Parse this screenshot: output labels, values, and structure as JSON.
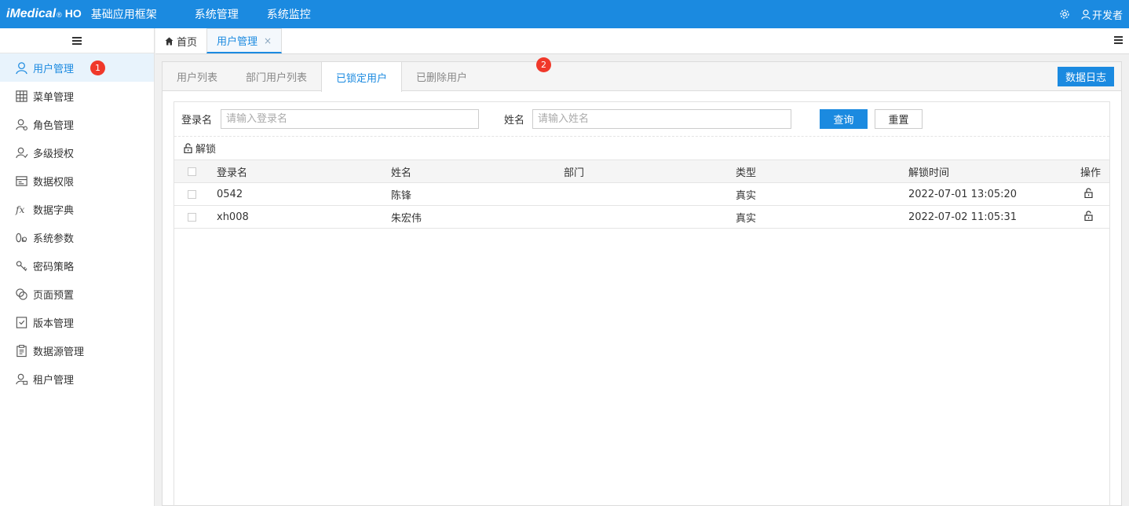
{
  "header": {
    "brand": "iMedical",
    "brand_mark": "®",
    "brand_suffix": "HO",
    "app_title": "基础应用框架",
    "nav": [
      "系统管理",
      "系统监控"
    ],
    "user": "开发者",
    "accent": "#1b8ae0"
  },
  "sidebar": {
    "items": [
      {
        "label": "用户管理",
        "icon": "user-icon",
        "active": true
      },
      {
        "label": "菜单管理",
        "icon": "grid-icon"
      },
      {
        "label": "角色管理",
        "icon": "role-icon"
      },
      {
        "label": "多级授权",
        "icon": "authorization-icon"
      },
      {
        "label": "数据权限",
        "icon": "data-permission-icon"
      },
      {
        "label": "数据字典",
        "icon": "fx-icon"
      },
      {
        "label": "系统参数",
        "icon": "parameter-icon"
      },
      {
        "label": "密码策略",
        "icon": "key-icon"
      },
      {
        "label": "页面预置",
        "icon": "overlap-circles-icon"
      },
      {
        "label": "版本管理",
        "icon": "version-icon"
      },
      {
        "label": "数据源管理",
        "icon": "clipboard-icon"
      },
      {
        "label": "租户管理",
        "icon": "tenant-icon"
      }
    ],
    "badge": "1"
  },
  "page_tabs": {
    "home": "首页",
    "active": "用户管理",
    "close": "×"
  },
  "content": {
    "tabs": [
      "用户列表",
      "部门用户列表",
      "已锁定用户",
      "已删除用户"
    ],
    "active_tab": "已锁定用户",
    "tab_badge": "2",
    "log_button": "数据日志"
  },
  "search": {
    "login_label": "登录名",
    "login_placeholder": "请输入登录名",
    "name_label": "姓名",
    "name_placeholder": "请输入姓名",
    "query_button": "查询",
    "reset_button": "重置"
  },
  "toolbar": {
    "unlock_label": "解锁"
  },
  "table": {
    "columns": [
      "登录名",
      "姓名",
      "部门",
      "类型",
      "解锁时间",
      "操作"
    ],
    "rows": [
      {
        "login": "0542",
        "name": "陈锋",
        "dept": "",
        "type": "真实",
        "unlock_time": "2022-07-01 13:05:20"
      },
      {
        "login": "xh008",
        "name": "朱宏伟",
        "dept": "",
        "type": "真实",
        "unlock_time": "2022-07-02 11:05:31"
      }
    ]
  }
}
